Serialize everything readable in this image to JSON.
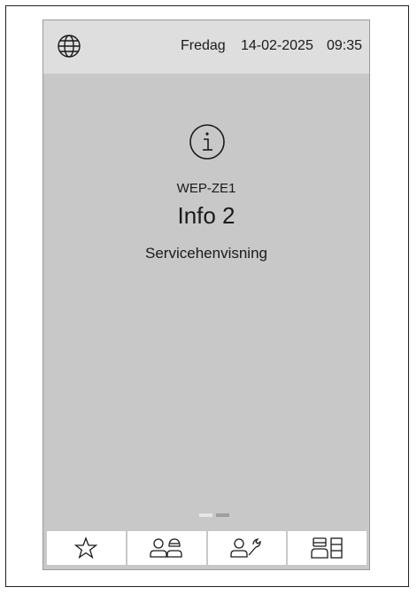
{
  "status_bar": {
    "day": "Fredag",
    "date": "14-02-2025",
    "time": "09:35",
    "language_icon": "globe-icon"
  },
  "message": {
    "icon": "info-icon",
    "device_code": "WEP-ZE1",
    "title": "Info 2",
    "subtitle": "Servicehenvisning"
  },
  "pager": {
    "page_count": 2,
    "current_page": 2
  },
  "bottom_nav": [
    {
      "icon": "star-icon"
    },
    {
      "icon": "users-icon"
    },
    {
      "icon": "user-wrench-icon"
    },
    {
      "icon": "user-rack-icon"
    }
  ]
}
